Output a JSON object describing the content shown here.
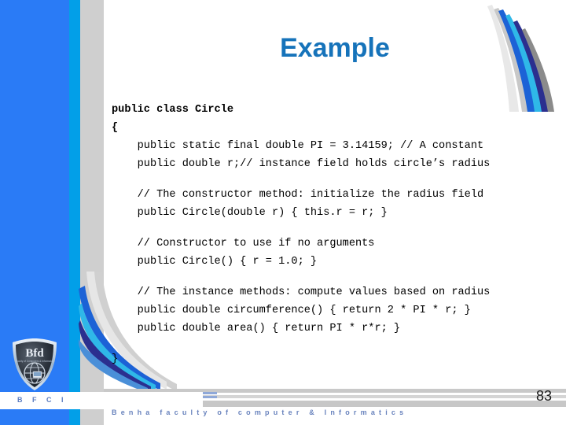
{
  "slide": {
    "title": "Example",
    "page_number": "83",
    "title_color": "#1673ba",
    "accent_blue": "#2a7bf6",
    "accent_cyan": "#029fe8",
    "accent_gray": "#cfcfcf"
  },
  "logo": {
    "name": "bfci-shield-logo",
    "wordmark": "Bfd",
    "subtitle": "Faculty of Computers & Informatics"
  },
  "footer": {
    "brand_short": "B F C I",
    "brand_long": "Benha faculty of computer & Informatics"
  },
  "code": {
    "language": "java",
    "lines": [
      {
        "text": "public class Circle",
        "bold": true,
        "indent": 0
      },
      {
        "text": "{",
        "bold": true,
        "indent": 0
      },
      {
        "text": "public static final double PI = 3.14159; // A constant",
        "bold": false,
        "indent": 1
      },
      {
        "text": "public double r;// instance field holds circle’s radius",
        "bold": false,
        "indent": 1
      },
      {
        "text": "",
        "bold": false,
        "indent": 0
      },
      {
        "text": "// The constructor method: initialize the radius field",
        "bold": false,
        "indent": 1
      },
      {
        "text": "public Circle(double r) { this.r = r; }",
        "bold": false,
        "indent": 1
      },
      {
        "text": "",
        "bold": false,
        "indent": 0
      },
      {
        "text": "// Constructor to use if no arguments",
        "bold": false,
        "indent": 1
      },
      {
        "text": "public Circle() { r = 1.0; }",
        "bold": false,
        "indent": 1
      },
      {
        "text": "",
        "bold": false,
        "indent": 0
      },
      {
        "text": "// The instance methods: compute values based on radius",
        "bold": false,
        "indent": 1
      },
      {
        "text": "public double circumference() { return 2 * PI * r; }",
        "bold": false,
        "indent": 1
      },
      {
        "text": "public double area() { return PI * r*r; }",
        "bold": false,
        "indent": 1
      },
      {
        "text": "",
        "bold": false,
        "indent": 0
      },
      {
        "text": "}",
        "bold": false,
        "indent": 0
      }
    ]
  },
  "decoration": {
    "swoosh_top_right": "ribbon-swoosh-icon",
    "swoosh_bottom_left": "ribbon-swoosh-icon",
    "ribbon_colors": [
      "#c8c8c8",
      "#1c62d6",
      "#2fb8e8",
      "#2b2f8f",
      "#8b8b8b"
    ]
  }
}
